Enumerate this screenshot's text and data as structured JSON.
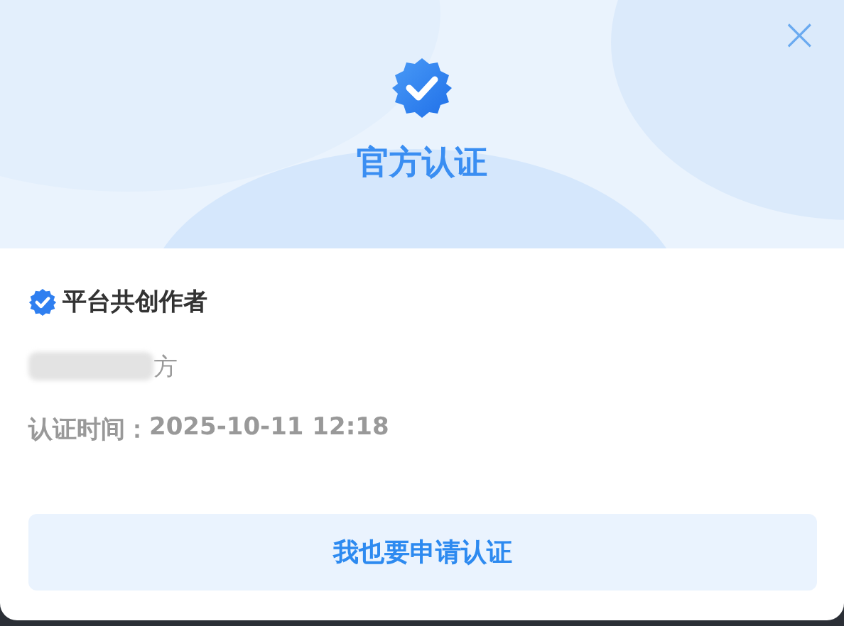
{
  "dialog": {
    "title": "官方认证",
    "close": "×"
  },
  "certification": {
    "type": "平台共创作者",
    "name": "方",
    "time_label": "认证时间：",
    "time": "2025-10-11 12:18"
  },
  "button": {
    "label": "我也要申请认证"
  }
}
